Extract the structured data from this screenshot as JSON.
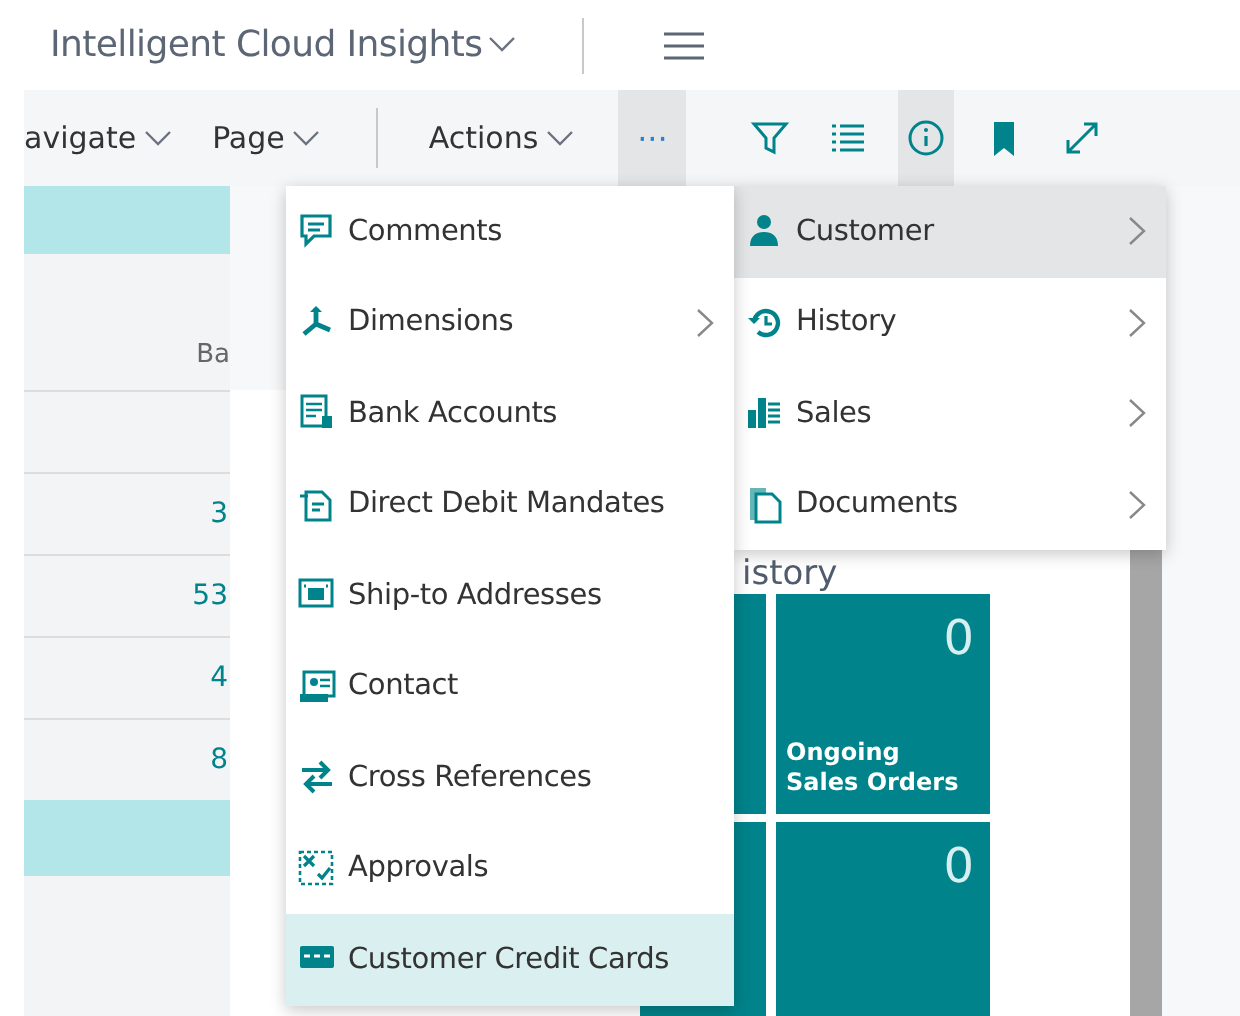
{
  "header": {
    "title": "Intelligent Cloud Insights"
  },
  "toolbar": {
    "menus": [
      {
        "label": "avigate"
      },
      {
        "label": "Page"
      },
      {
        "label": "Actions"
      }
    ],
    "more": {
      "label": "···",
      "selected": true
    },
    "icons": [
      {
        "kind": "filter",
        "selected": false
      },
      {
        "kind": "list",
        "selected": false
      },
      {
        "kind": "info",
        "selected": true
      },
      {
        "kind": "bookmark",
        "selected": false
      },
      {
        "kind": "expand",
        "selected": false
      }
    ]
  },
  "list": {
    "column_1": "Ba",
    "rows": [
      {
        "selected": false
      },
      {
        "value": "3",
        "selected": false
      },
      {
        "value": "53",
        "selected": false
      },
      {
        "value": "4",
        "selected": false
      },
      {
        "value": "8",
        "selected": false
      },
      {
        "selected": true
      }
    ]
  },
  "factbox": {
    "heading": "istory",
    "tiles": [
      {
        "kind": "hidden"
      },
      {
        "kind": "tile",
        "value": "0",
        "label": "Ongoing Sales Orders"
      },
      {
        "kind": "hidden"
      },
      {
        "kind": "tile",
        "value": "0"
      }
    ]
  },
  "actions_menu": {
    "items": [
      {
        "kind": "comment",
        "label": "Comments",
        "submenu": false,
        "selected": false
      },
      {
        "kind": "dimensions",
        "label": "Dimensions",
        "submenu": true,
        "selected": false
      },
      {
        "kind": "bank",
        "label": "Bank Accounts",
        "submenu": false,
        "selected": false
      },
      {
        "kind": "mandate",
        "label": "Direct Debit Mandates",
        "submenu": false,
        "selected": false
      },
      {
        "kind": "shipto",
        "label": "Ship-to Addresses",
        "submenu": false,
        "selected": false
      },
      {
        "kind": "contact",
        "label": "Contact",
        "submenu": false,
        "selected": false
      },
      {
        "kind": "crossref",
        "label": "Cross References",
        "submenu": false,
        "selected": false
      },
      {
        "kind": "approvals",
        "label": "Approvals",
        "submenu": false,
        "selected": false
      },
      {
        "kind": "card",
        "label": "Customer Credit Cards",
        "submenu": false,
        "selected": true
      }
    ]
  },
  "related_menu": {
    "items": [
      {
        "kind": "person",
        "label": "Customer",
        "submenu": true,
        "selected": true
      },
      {
        "kind": "history",
        "label": "History",
        "submenu": true,
        "selected": false
      },
      {
        "kind": "sales",
        "label": "Sales",
        "submenu": true,
        "selected": false
      },
      {
        "kind": "documents",
        "label": "Documents",
        "submenu": true,
        "selected": false
      }
    ]
  }
}
